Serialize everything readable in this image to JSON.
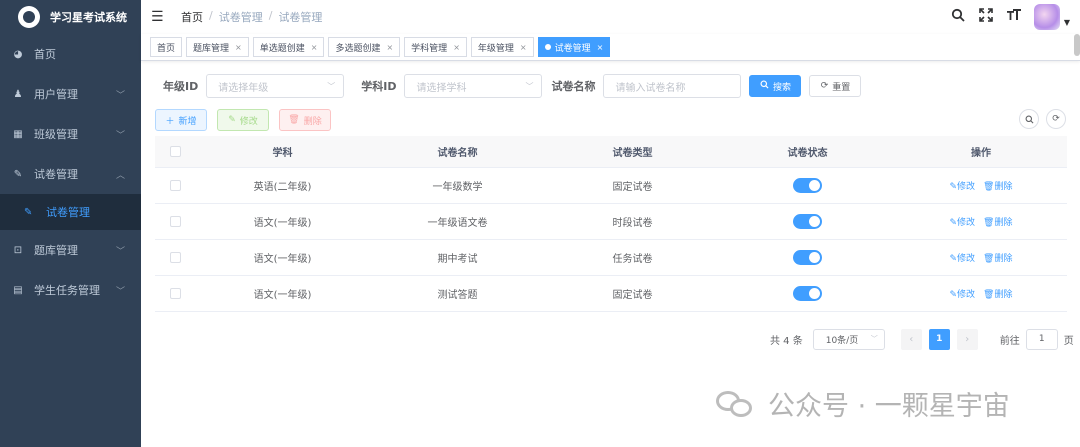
{
  "app": {
    "title": "学习星考试系统"
  },
  "sidebar": {
    "items": [
      {
        "label": "首页",
        "icon": "dashboard-icon",
        "glyph": "◕"
      },
      {
        "label": "用户管理",
        "icon": "user-icon",
        "glyph": "♟"
      },
      {
        "label": "班级管理",
        "icon": "class-icon",
        "glyph": "▦"
      },
      {
        "label": "试卷管理",
        "icon": "edit-icon",
        "glyph": "✎"
      },
      {
        "label": "试卷管理",
        "icon": "edit-icon",
        "glyph": "✎"
      },
      {
        "label": "题库管理",
        "icon": "book-icon",
        "glyph": "⊡"
      },
      {
        "label": "学生任务管理",
        "icon": "task-icon",
        "glyph": "▤"
      }
    ]
  },
  "header": {
    "breadcrumb": [
      "首页",
      "试卷管理",
      "试卷管理"
    ],
    "separator": "/"
  },
  "tags": [
    {
      "label": "首页",
      "closable": false
    },
    {
      "label": "题库管理",
      "closable": true
    },
    {
      "label": "单选题创建",
      "closable": true
    },
    {
      "label": "多选题创建",
      "closable": true
    },
    {
      "label": "学科管理",
      "closable": true
    },
    {
      "label": "年级管理",
      "closable": true
    },
    {
      "label": "试卷管理",
      "closable": true,
      "active": true
    }
  ],
  "filters": {
    "grade_label": "年级ID",
    "grade_placeholder": "请选择年级",
    "subject_label": "学科ID",
    "subject_placeholder": "请选择学科",
    "name_label": "试卷名称",
    "name_placeholder": "请输入试卷名称",
    "search_label": "搜索",
    "reset_label": "重置"
  },
  "toolbar": {
    "add_label": "新增",
    "edit_label": "修改",
    "delete_label": "删除"
  },
  "table": {
    "columns": [
      "学科",
      "试卷名称",
      "试卷类型",
      "试卷状态",
      "操作"
    ],
    "rows": [
      {
        "subject": "英语(二年级)",
        "name": "一年级数学",
        "type": "固定试卷",
        "status": true
      },
      {
        "subject": "语文(一年级)",
        "name": "一年级语文卷",
        "type": "时段试卷",
        "status": true
      },
      {
        "subject": "语文(一年级)",
        "name": "期中考试",
        "type": "任务试卷",
        "status": true
      },
      {
        "subject": "语文(一年级)",
        "name": "测试答题",
        "type": "固定试卷",
        "status": true
      }
    ],
    "row_edit": "修改",
    "row_delete": "删除"
  },
  "pagination": {
    "total_text": "共 4 条",
    "page_size": "10条/页",
    "current_page": "1",
    "goto_label": "前往",
    "goto_value": "1",
    "page_suffix": "页"
  },
  "watermark": {
    "text": "公众号 · 一颗星宇宙"
  },
  "colors": {
    "primary": "#409eff",
    "sidebar": "#304156"
  }
}
